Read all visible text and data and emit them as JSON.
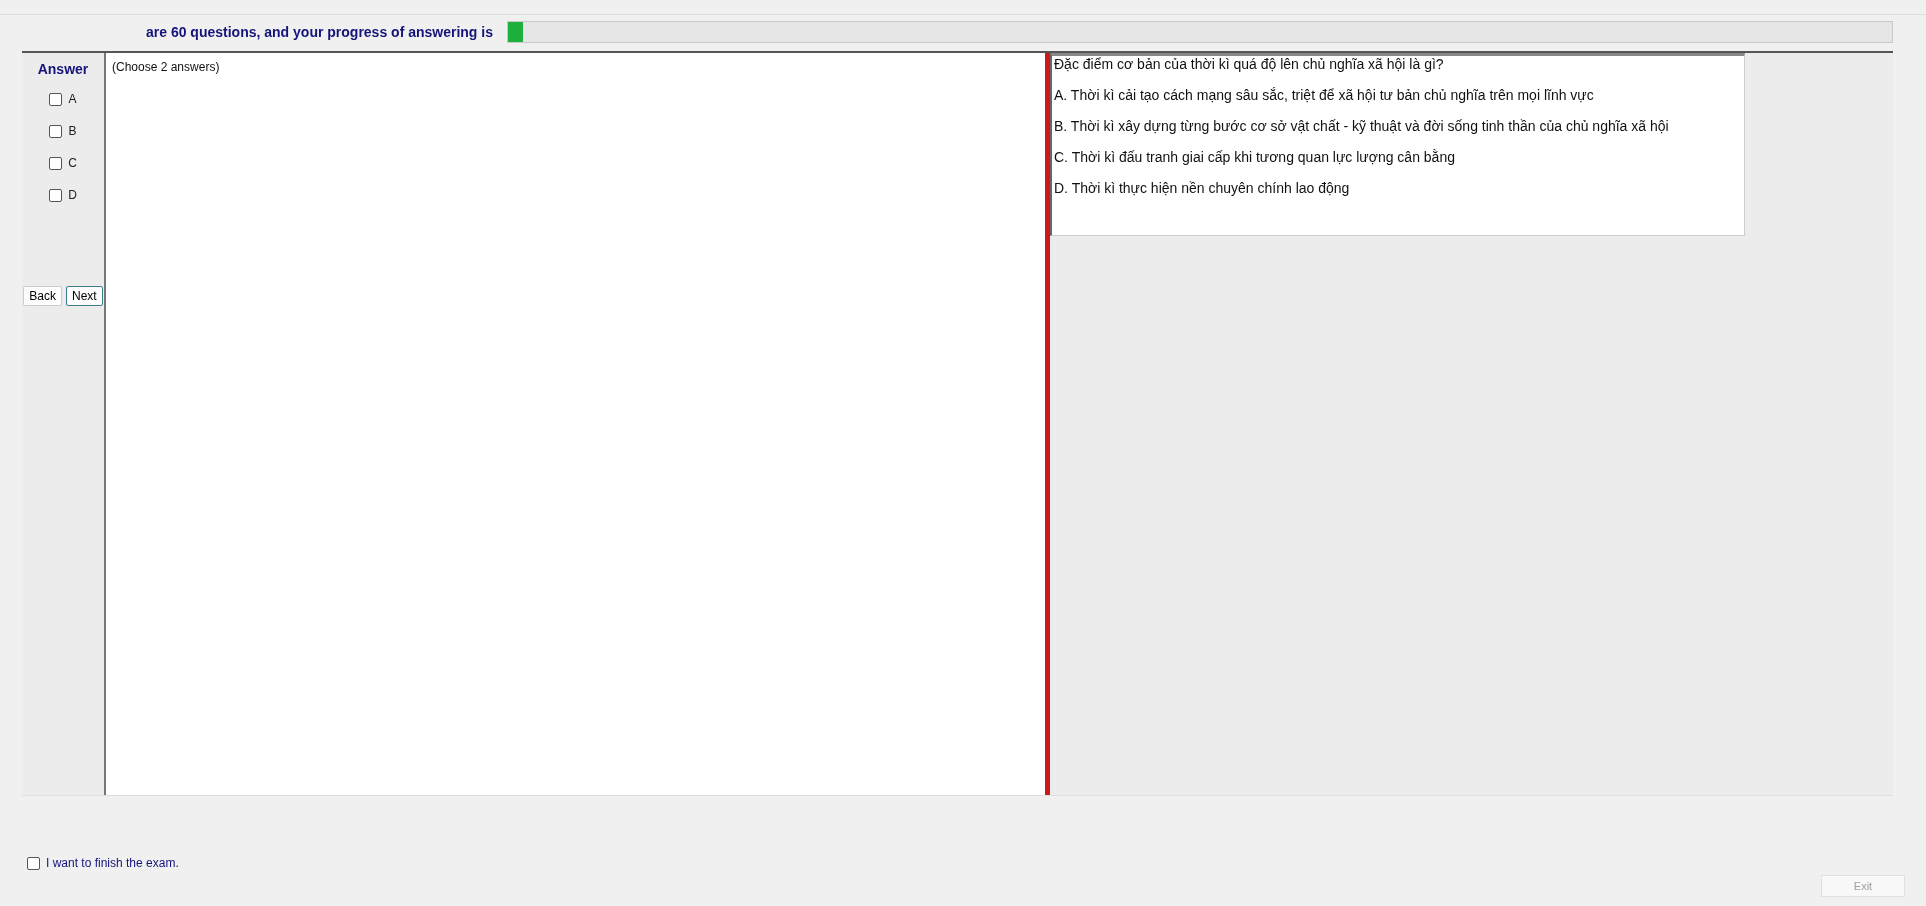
{
  "header": {
    "text": "are 60 questions, and your progress of answering is",
    "progress": {
      "level": 0.011
    }
  },
  "answer_panel": {
    "title": "Answer",
    "options": [
      {
        "label": "A",
        "checked": false
      },
      {
        "label": "B",
        "checked": false
      },
      {
        "label": "C",
        "checked": false
      },
      {
        "label": "D",
        "checked": false
      }
    ],
    "buttons": [
      {
        "label": "Back",
        "focused": false
      },
      {
        "label": "Next",
        "focused": true
      }
    ]
  },
  "answer_area": {
    "hint": "(Choose 2 answers)"
  },
  "question": {
    "text": "Đặc điểm cơ bản của thời kì quá độ lên chủ nghĩa xã hội là gì?",
    "choices": [
      "A.  Thời kì cải tạo cách mạng sâu sắc, triệt để xã hội tư bản chủ nghĩa trên mọi lĩnh vực",
      "B.  Thời kì xây dựng từng bước cơ sở vật chất - kỹ thuật và đời sống tinh thần của chủ nghĩa xã hội",
      "C.  Thời kì đấu tranh giai cấp khi tương quan lực lượng cân bằng",
      "D.  Thời kì thực hiện nền chuyên chính lao động"
    ]
  },
  "finish": {
    "label": "I want to finish the exam.",
    "checked": false
  },
  "exit_button": {
    "label": "Exit",
    "disabled": true
  }
}
